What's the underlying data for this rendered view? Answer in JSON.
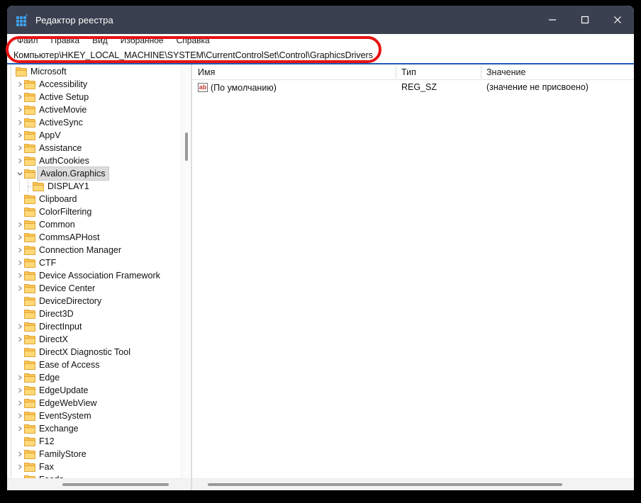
{
  "window": {
    "title": "Редактор реестра",
    "icon": "registry-editor-icon",
    "controls": {
      "minimize": "minimize-icon",
      "maximize": "maximize-icon",
      "close": "close-icon"
    }
  },
  "menubar": {
    "items": [
      {
        "label": "Файл"
      },
      {
        "label": "Правка"
      },
      {
        "label": "Вид"
      },
      {
        "label": "Избранное"
      },
      {
        "label": "Справка"
      }
    ]
  },
  "address": {
    "value": "Компьютер\\HKEY_LOCAL_MACHINE\\SYSTEM\\CurrentControlSet\\Control\\GraphicsDrivers"
  },
  "annotation": {
    "shape": "ellipse",
    "color": "#e81313",
    "target": "address-bar"
  },
  "tree": {
    "items": [
      {
        "label": "Microsoft",
        "indent": 0,
        "expander": "none",
        "selected": false
      },
      {
        "label": "Accessibility",
        "indent": 1,
        "expander": "collapsed",
        "selected": false
      },
      {
        "label": "Active Setup",
        "indent": 1,
        "expander": "collapsed",
        "selected": false
      },
      {
        "label": "ActiveMovie",
        "indent": 1,
        "expander": "collapsed",
        "selected": false
      },
      {
        "label": "ActiveSync",
        "indent": 1,
        "expander": "collapsed",
        "selected": false
      },
      {
        "label": "AppV",
        "indent": 1,
        "expander": "collapsed",
        "selected": false
      },
      {
        "label": "Assistance",
        "indent": 1,
        "expander": "collapsed",
        "selected": false
      },
      {
        "label": "AuthCookies",
        "indent": 1,
        "expander": "collapsed",
        "selected": false
      },
      {
        "label": "Avalon.Graphics",
        "indent": 1,
        "expander": "expanded",
        "selected": true
      },
      {
        "label": "DISPLAY1",
        "indent": 2,
        "expander": "none",
        "selected": false
      },
      {
        "label": "Clipboard",
        "indent": 1,
        "expander": "none",
        "selected": false
      },
      {
        "label": "ColorFiltering",
        "indent": 1,
        "expander": "none",
        "selected": false
      },
      {
        "label": "Common",
        "indent": 1,
        "expander": "collapsed",
        "selected": false
      },
      {
        "label": "CommsAPHost",
        "indent": 1,
        "expander": "collapsed",
        "selected": false
      },
      {
        "label": "Connection Manager",
        "indent": 1,
        "expander": "collapsed",
        "selected": false
      },
      {
        "label": "CTF",
        "indent": 1,
        "expander": "collapsed",
        "selected": false
      },
      {
        "label": "Device Association Framework",
        "indent": 1,
        "expander": "collapsed",
        "selected": false
      },
      {
        "label": "Device Center",
        "indent": 1,
        "expander": "collapsed",
        "selected": false
      },
      {
        "label": "DeviceDirectory",
        "indent": 1,
        "expander": "none",
        "selected": false
      },
      {
        "label": "Direct3D",
        "indent": 1,
        "expander": "none",
        "selected": false
      },
      {
        "label": "DirectInput",
        "indent": 1,
        "expander": "collapsed",
        "selected": false
      },
      {
        "label": "DirectX",
        "indent": 1,
        "expander": "collapsed",
        "selected": false
      },
      {
        "label": "DirectX Diagnostic Tool",
        "indent": 1,
        "expander": "none",
        "selected": false
      },
      {
        "label": "Ease of Access",
        "indent": 1,
        "expander": "none",
        "selected": false
      },
      {
        "label": "Edge",
        "indent": 1,
        "expander": "collapsed",
        "selected": false
      },
      {
        "label": "EdgeUpdate",
        "indent": 1,
        "expander": "collapsed",
        "selected": false
      },
      {
        "label": "EdgeWebView",
        "indent": 1,
        "expander": "collapsed",
        "selected": false
      },
      {
        "label": "EventSystem",
        "indent": 1,
        "expander": "collapsed",
        "selected": false
      },
      {
        "label": "Exchange",
        "indent": 1,
        "expander": "collapsed",
        "selected": false
      },
      {
        "label": "F12",
        "indent": 1,
        "expander": "none",
        "selected": false
      },
      {
        "label": "FamilyStore",
        "indent": 1,
        "expander": "collapsed",
        "selected": false
      },
      {
        "label": "Fax",
        "indent": 1,
        "expander": "collapsed",
        "selected": false
      },
      {
        "label": "Feeds",
        "indent": 1,
        "expander": "none",
        "selected": false
      }
    ]
  },
  "values": {
    "columns": [
      {
        "label": "Имя"
      },
      {
        "label": "Тип"
      },
      {
        "label": "Значение"
      }
    ],
    "rows": [
      {
        "icon": "string-value-icon",
        "name": "(По умолчанию)",
        "type": "REG_SZ",
        "data": "(значение не присвоено)"
      }
    ]
  }
}
